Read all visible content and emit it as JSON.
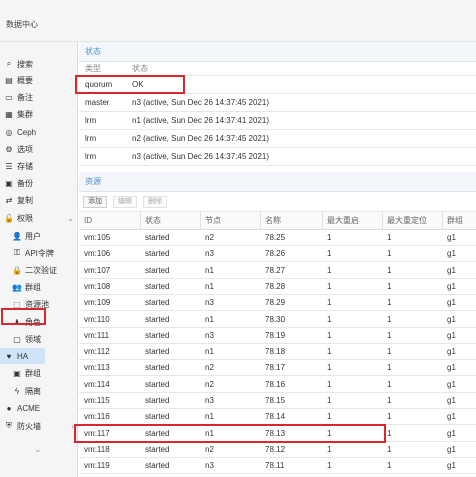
{
  "topbar": {
    "breadcrumb": "数据中心"
  },
  "sidebar": {
    "items": [
      {
        "label": "搜索",
        "icon": "search-icon",
        "glyph": "⌕",
        "level": 0,
        "selected": false
      },
      {
        "label": "概要",
        "icon": "book-icon",
        "glyph": "▤",
        "level": 0,
        "selected": false
      },
      {
        "label": "备注",
        "icon": "note-icon",
        "glyph": "▭",
        "level": 0,
        "selected": false
      },
      {
        "label": "集群",
        "icon": "server-icon",
        "glyph": "▦",
        "level": 0,
        "selected": false
      },
      {
        "label": "Ceph",
        "icon": "ceph-icon",
        "glyph": "◎",
        "level": 0,
        "selected": false
      },
      {
        "label": "选项",
        "icon": "gear-icon",
        "glyph": "⚙",
        "level": 0,
        "selected": false
      },
      {
        "label": "存储",
        "icon": "database-icon",
        "glyph": "☰",
        "level": 0,
        "selected": false
      },
      {
        "label": "备份",
        "icon": "backup-icon",
        "glyph": "▣",
        "level": 0,
        "selected": false
      },
      {
        "label": "复制",
        "icon": "retweet-icon",
        "glyph": "⇄",
        "level": 0,
        "selected": false
      },
      {
        "label": "权限",
        "icon": "unlock-icon",
        "glyph": "🔓",
        "level": 0,
        "selected": false,
        "chevron": "⌄"
      },
      {
        "label": "用户",
        "icon": "user-icon",
        "glyph": "👤",
        "level": 1,
        "selected": false
      },
      {
        "label": "API令牌",
        "icon": "key-icon",
        "glyph": "⚿",
        "level": 1,
        "selected": false
      },
      {
        "label": "二次验证",
        "icon": "lock-icon",
        "glyph": "🔒",
        "level": 1,
        "selected": false
      },
      {
        "label": "群组",
        "icon": "users-icon",
        "glyph": "👥",
        "level": 1,
        "selected": false
      },
      {
        "label": "资源池",
        "icon": "tags-icon",
        "glyph": "⬚",
        "level": 1,
        "selected": false
      },
      {
        "label": "角色",
        "icon": "male-icon",
        "glyph": "♟",
        "level": 1,
        "selected": false
      },
      {
        "label": "领域",
        "icon": "realm-icon",
        "glyph": "▢",
        "level": 1,
        "selected": false
      },
      {
        "label": "HA",
        "icon": "heartbeat-icon",
        "glyph": "♥",
        "level": 0,
        "selected": true
      },
      {
        "label": "群组",
        "icon": "object-group-icon",
        "glyph": "▣",
        "level": 1,
        "selected": false
      },
      {
        "label": "隔离",
        "icon": "bolt-icon",
        "glyph": "ϟ",
        "level": 1,
        "selected": false
      },
      {
        "label": "ACME",
        "icon": "certificate-icon",
        "glyph": "●",
        "level": 0,
        "selected": false
      },
      {
        "label": "防火墙",
        "icon": "shield-icon",
        "glyph": "⛨",
        "level": 0,
        "selected": false,
        "chevron": "›"
      }
    ],
    "scroll_chevron": "⌄"
  },
  "status_panel": {
    "title": "状态",
    "columns": [
      "类型",
      "状态"
    ],
    "rows": [
      {
        "type": "quorum",
        "status": "OK"
      },
      {
        "type": "master",
        "status": "n3 (active, Sun Dec 26 14:37:45 2021)"
      },
      {
        "type": "lrm",
        "status": "n1 (active, Sun Dec 26 14:37:41 2021)"
      },
      {
        "type": "lrm",
        "status": "n2 (active, Sun Dec 26 14:37:45 2021)"
      },
      {
        "type": "lrm",
        "status": "n3 (active, Sun Dec 26 14:37:45 2021)"
      }
    ]
  },
  "resources_panel": {
    "title": "资源",
    "toolbar": {
      "add": "添加",
      "edit": "编辑",
      "remove": "删除"
    },
    "columns": [
      "ID",
      "状态",
      "节点",
      "名称",
      "最大重启",
      "最大重定位",
      "群组"
    ],
    "rows": [
      {
        "id": "vm:105",
        "state": "started",
        "node": "n2",
        "name": "78.25",
        "max_restart": "1",
        "max_relocate": "1",
        "group": "g1"
      },
      {
        "id": "vm:106",
        "state": "started",
        "node": "n3",
        "name": "78.26",
        "max_restart": "1",
        "max_relocate": "1",
        "group": "g1"
      },
      {
        "id": "vm:107",
        "state": "started",
        "node": "n1",
        "name": "78.27",
        "max_restart": "1",
        "max_relocate": "1",
        "group": "g1"
      },
      {
        "id": "vm:108",
        "state": "started",
        "node": "n1",
        "name": "78.28",
        "max_restart": "1",
        "max_relocate": "1",
        "group": "g1"
      },
      {
        "id": "vm:109",
        "state": "started",
        "node": "n3",
        "name": "78.29",
        "max_restart": "1",
        "max_relocate": "1",
        "group": "g1"
      },
      {
        "id": "vm:110",
        "state": "started",
        "node": "n1",
        "name": "78.30",
        "max_restart": "1",
        "max_relocate": "1",
        "group": "g1"
      },
      {
        "id": "vm:111",
        "state": "started",
        "node": "n3",
        "name": "78.19",
        "max_restart": "1",
        "max_relocate": "1",
        "group": "g1"
      },
      {
        "id": "vm:112",
        "state": "started",
        "node": "n1",
        "name": "78.18",
        "max_restart": "1",
        "max_relocate": "1",
        "group": "g1"
      },
      {
        "id": "vm:113",
        "state": "started",
        "node": "n2",
        "name": "78.17",
        "max_restart": "1",
        "max_relocate": "1",
        "group": "g1"
      },
      {
        "id": "vm:114",
        "state": "started",
        "node": "n2",
        "name": "78.16",
        "max_restart": "1",
        "max_relocate": "1",
        "group": "g1"
      },
      {
        "id": "vm:115",
        "state": "started",
        "node": "n3",
        "name": "78.15",
        "max_restart": "1",
        "max_relocate": "1",
        "group": "g1"
      },
      {
        "id": "vm:116",
        "state": "started",
        "node": "n1",
        "name": "78.14",
        "max_restart": "1",
        "max_relocate": "1",
        "group": "g1"
      },
      {
        "id": "vm:117",
        "state": "started",
        "node": "n1",
        "name": "78.13",
        "max_restart": "1",
        "max_relocate": "1",
        "group": "g1"
      },
      {
        "id": "vm:118",
        "state": "started",
        "node": "n2",
        "name": "78.12",
        "max_restart": "1",
        "max_relocate": "1",
        "group": "g1"
      },
      {
        "id": "vm:119",
        "state": "started",
        "node": "n3",
        "name": "78.11",
        "max_restart": "1",
        "max_relocate": "1",
        "group": "g1"
      }
    ]
  },
  "colors": {
    "highlight_box": "#d9272e",
    "accent": "#4a8fd0",
    "selected_bg": "#cfe4f8"
  }
}
